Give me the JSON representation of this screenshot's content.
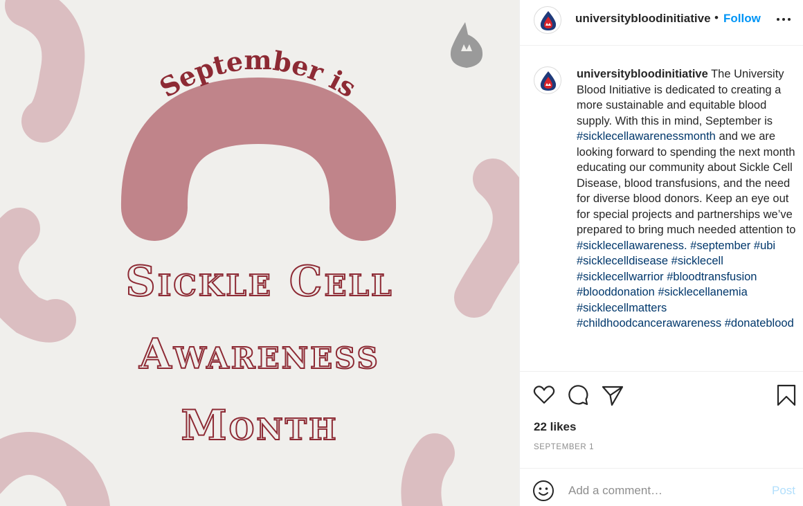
{
  "colors": {
    "image_background": "#f0efec",
    "blob_light": "#dbbec1",
    "arch": "#c0848a",
    "headline_stroke": "#8d2a34",
    "link_blue": "#0095f6",
    "hashtag_blue": "#00376b",
    "post_button_disabled": "#b2dffc"
  },
  "image": {
    "arched_title": "September is",
    "headline_lines": [
      "Sickle Cell",
      "Awareness",
      "Month"
    ],
    "logo_icon": "flame-drop-logo-icon"
  },
  "header": {
    "avatar_icon": "blood-drop-avatar-icon",
    "username": "universitybloodinitiative",
    "separator": "•",
    "follow_label": "Follow",
    "more_icon": "more-options-icon"
  },
  "caption": {
    "username": "universitybloodinitiative",
    "text_part1": " The University Blood Initiative is dedicated to creating a more sustainable and equitable blood supply. With this in mind, September is ",
    "hashtag_month": "#sicklecellawarenessmonth",
    "text_part2": " and we are looking forward to spending the next month educating our community about Sickle Cell Disease, blood transfusions, and the need for diverse blood donors. Keep an eye out for special projects and partnerships we’ve prepared to bring much needed attention to ",
    "hashtags": [
      "#sicklecellawareness.",
      "#september",
      "#ubi",
      "#sicklecelldisease",
      "#sicklecell",
      "#sicklecellwarrior",
      "#bloodtransfusion",
      "#blooddonation",
      "#sicklecellanemia",
      "#sicklecellmatters",
      "#childhoodcancerawareness",
      "#donateblood"
    ]
  },
  "actions": {
    "like_icon": "heart-icon",
    "comment_icon": "comment-bubble-icon",
    "share_icon": "paper-plane-icon",
    "save_icon": "bookmark-icon",
    "likes_text": "22 likes",
    "date_text": "SEPTEMBER 1"
  },
  "add_comment": {
    "emoji_icon": "emoji-smiley-icon",
    "placeholder": "Add a comment…",
    "post_label": "Post"
  }
}
